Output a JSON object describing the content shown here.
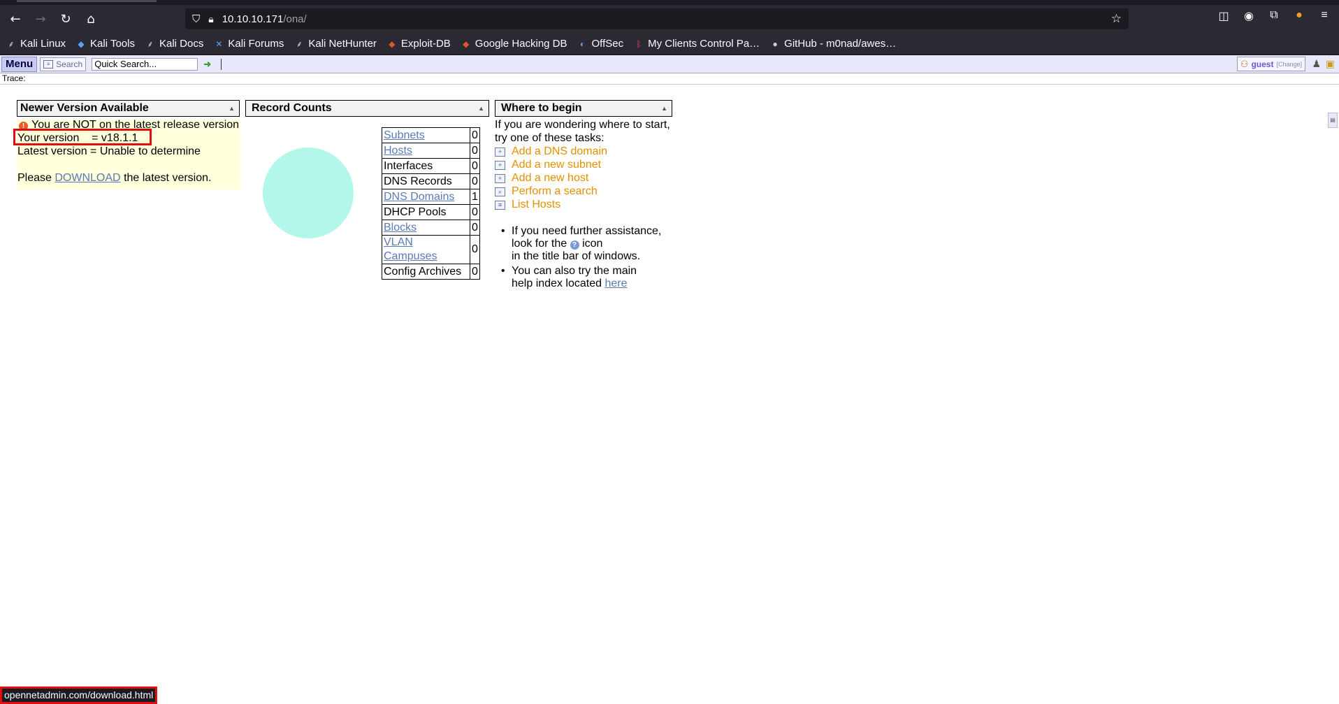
{
  "browser": {
    "url_host": "10.10.10.171",
    "url_path": "/ona/",
    "bookmarks": [
      {
        "label": "Kali Linux",
        "icon": "kali-dragon-icon"
      },
      {
        "label": "Kali Tools",
        "icon": "kali-tools-icon"
      },
      {
        "label": "Kali Docs",
        "icon": "kali-dragon-icon"
      },
      {
        "label": "Kali Forums",
        "icon": "kali-forums-icon"
      },
      {
        "label": "Kali NetHunter",
        "icon": "kali-dragon-icon"
      },
      {
        "label": "Exploit-DB",
        "icon": "exploit-db-icon"
      },
      {
        "label": "Google Hacking DB",
        "icon": "exploit-db-icon"
      },
      {
        "label": "OffSec",
        "icon": "offsec-icon"
      },
      {
        "label": "My Clients Control Pa…",
        "icon": "clients-icon"
      },
      {
        "label": "GitHub - m0nad/awes…",
        "icon": "github-icon"
      }
    ],
    "status_url": "opennetadmin.com/download.html"
  },
  "appbar": {
    "menu_label": "Menu",
    "search_label": "Search",
    "quick_search_value": "Quick Search...",
    "user_name": "guest",
    "change_label": "[Change]"
  },
  "trace": {
    "label": "Trace:"
  },
  "version_panel": {
    "title": "Newer Version Available",
    "warning": "You are NOT on the latest release version",
    "your_version": "Your version    = v18.1.1",
    "latest_version": "Latest version = Unable to determine",
    "please_prefix": "Please",
    "download_link": "DOWNLOAD",
    "please_suffix": "the latest version."
  },
  "counts_panel": {
    "title": "Record Counts",
    "rows": [
      {
        "label": "Subnets",
        "count": "0",
        "link": true
      },
      {
        "label": "Hosts",
        "count": "0",
        "link": true
      },
      {
        "label": "Interfaces",
        "count": "0",
        "link": false
      },
      {
        "label": "DNS Records",
        "count": "0",
        "link": false
      },
      {
        "label": "DNS Domains",
        "count": "1",
        "link": true
      },
      {
        "label": "DHCP Pools",
        "count": "0",
        "link": false
      },
      {
        "label": "Blocks",
        "count": "0",
        "link": true
      },
      {
        "label": "VLAN Campuses",
        "count": "0",
        "link": true
      },
      {
        "label": "Config Archives",
        "count": "0",
        "link": false
      }
    ]
  },
  "begin_panel": {
    "title": "Where to begin",
    "intro_line1": "If you are wondering where to start,",
    "intro_line2": "try one of these tasks:",
    "tasks": [
      {
        "label": "Add a DNS domain",
        "icon": "add-doc-icon"
      },
      {
        "label": "Add a new subnet",
        "icon": "add-doc-icon"
      },
      {
        "label": "Add a new host",
        "icon": "add-doc-icon"
      },
      {
        "label": "Perform a search",
        "icon": "search-doc-icon"
      },
      {
        "label": "List Hosts",
        "icon": "list-icon"
      }
    ],
    "help1_line1": "If you need further assistance,",
    "help1_line2a": "look for the",
    "help1_line2b": "icon",
    "help1_line3": "in the title bar of windows.",
    "help2_line1": "You can also try the main",
    "help2_line2": "help index located",
    "help2_link": "here"
  },
  "colors": {
    "chrome_bg": "#2b2a33",
    "app_bar": "#e8e8fb",
    "version_bg": "#ffffdc",
    "task_orange": "#e29000",
    "pie_fill": "#b3f7ea",
    "highlight_red": "#e01010"
  }
}
